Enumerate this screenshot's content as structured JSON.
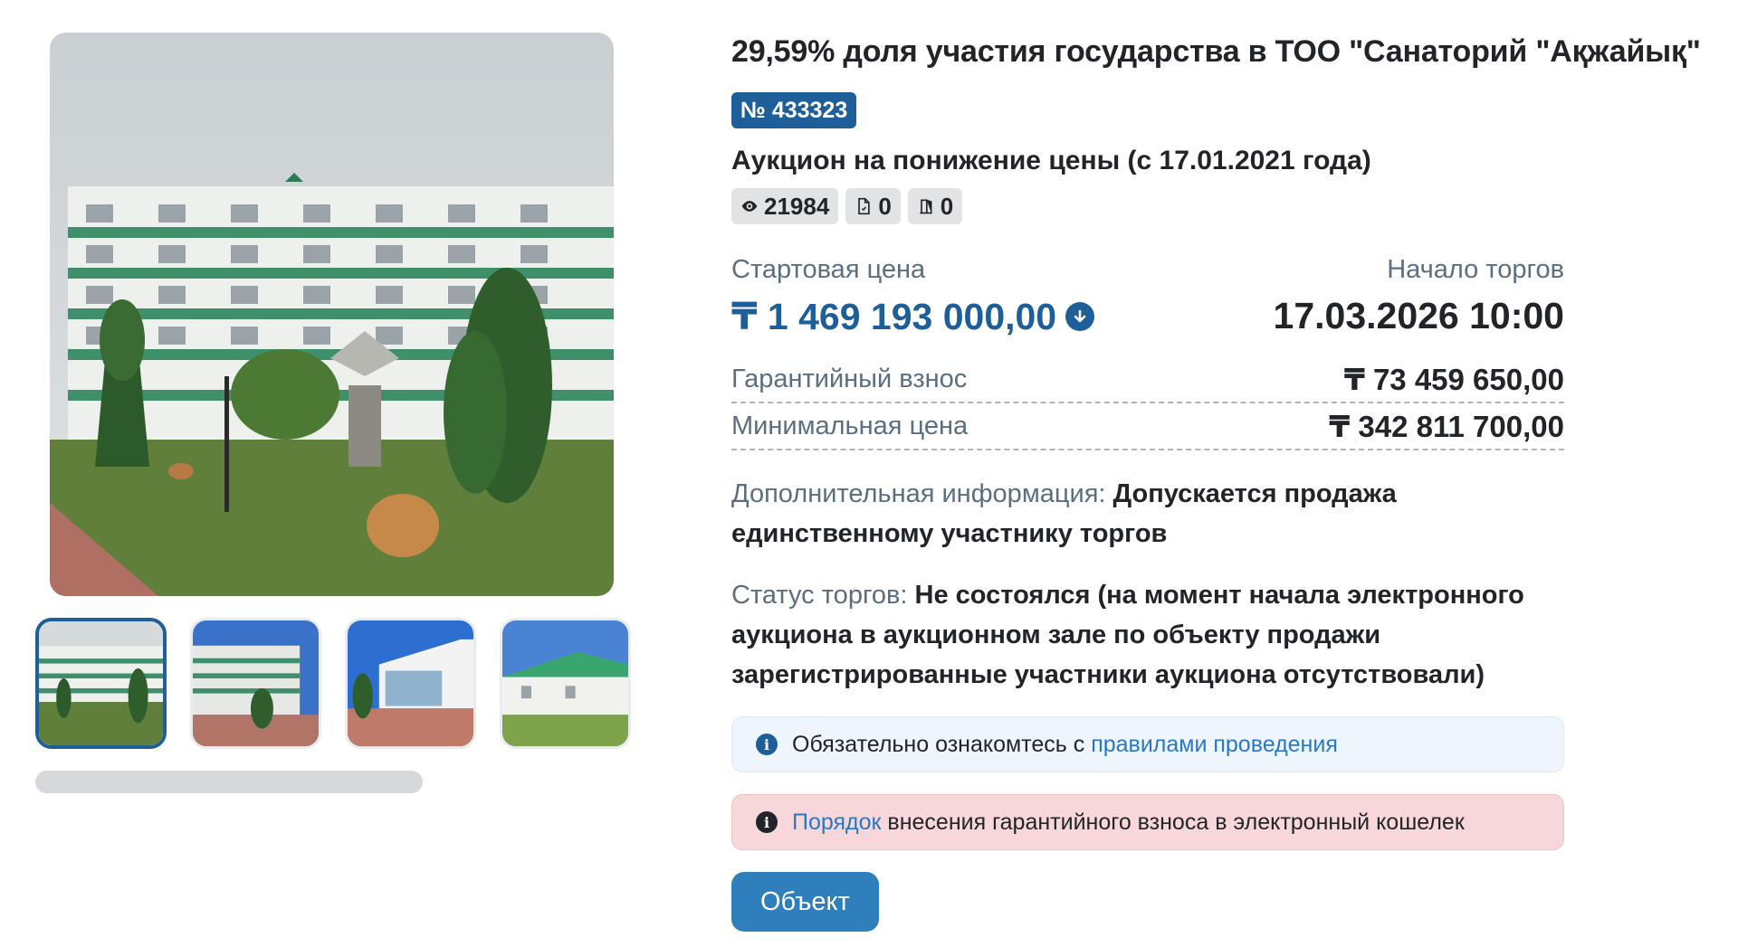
{
  "lot": {
    "title": "29,59% доля участия государства в ТОО \"Санаторий \"Ақжайық\"",
    "number": "№ 433323",
    "auction_type": "Аукцион на понижение цены (с 17.01.2021 года)",
    "stats": {
      "views": "21984",
      "documents": "0",
      "bids": "0"
    }
  },
  "pricing": {
    "start_price_label": "Стартовая цена",
    "start_price": "₸ 1 469 193 000,00",
    "start_date_label": "Начало торгов",
    "start_date": "17.03.2026 10:00",
    "deposit_label": "Гарантийный взнос",
    "deposit": "₸ 73 459 650,00",
    "min_price_label": "Минимальная цена",
    "min_price": "₸ 342 811 700,00"
  },
  "extra_info": {
    "label": "Дополнительная информация:",
    "value": "Допускается продажа единственному участнику торгов"
  },
  "status": {
    "label": "Статус торгов:",
    "value": "Не состоялся (на момент начала электронного аукциона в аукционном зале по объекту продажи зарегистрированные участники аукциона отсутствовали)"
  },
  "alerts": {
    "info_text": "Обязательно ознакомтесь с",
    "info_link": "правилами проведения",
    "danger_link": "Порядок",
    "danger_text": "внесения гарантийного взноса в электронный кошелек"
  },
  "buttons": {
    "object": "Объект"
  },
  "icons": {
    "views": "eye-icon",
    "documents": "file-icon",
    "bids": "door-icon",
    "price_trend": "arrow-down-circle-icon",
    "info": "info-icon"
  },
  "colors": {
    "primary": "#1f5f99",
    "link": "#2a78c2",
    "button": "#2f7fbd",
    "info_bg": "#eef5fc",
    "danger_bg": "#f8d7da"
  }
}
